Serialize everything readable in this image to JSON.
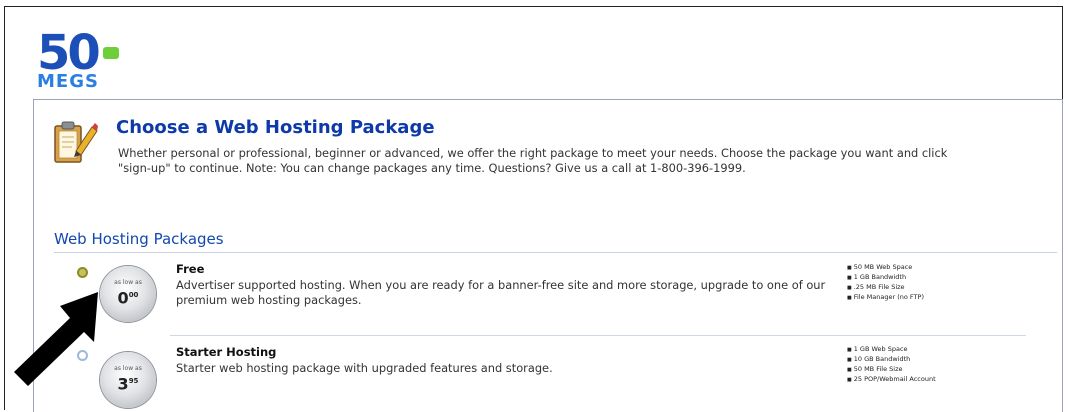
{
  "logo": {
    "number": "50",
    "sub": "MEGS"
  },
  "header": {
    "title": "Choose a Web Hosting Package",
    "intro": "Whether personal or professional, beginner or advanced, we offer the right package to meet your needs. Choose the package you want and click \"sign-up\" to continue. Note: You can change packages any time. Questions? Give us a call at 1-800-396-1999."
  },
  "section": {
    "title": "Web Hosting Packages"
  },
  "packages": [
    {
      "name": "Free",
      "price_prefix": "as low as",
      "price": "0",
      "price_cents": "00",
      "description": "Advertiser supported hosting. When you are ready for a banner-free site and more storage, upgrade to one of our premium web hosting packages.",
      "features": [
        "50 MB Web Space",
        "1 GB Bandwidth",
        ".25 MB File Size",
        "File Manager (no FTP)"
      ],
      "selected": true
    },
    {
      "name": "Starter Hosting",
      "price_prefix": "as low as",
      "price": "3",
      "price_cents": "95",
      "description": "Starter web hosting package with upgraded features and storage.",
      "features": [
        "1 GB Web Space",
        "10 GB Bandwidth",
        "50 MB File Size",
        "25 POP/Webmail Account"
      ],
      "selected": false
    }
  ],
  "colors": {
    "brand": "#1d4fb8",
    "accent_green": "#6ecf3a",
    "title_blue": "#0d3aa8"
  },
  "icons": {
    "header_icon": "clipboard-pencil-icon",
    "annotation": "arrow-pointer-icon"
  }
}
